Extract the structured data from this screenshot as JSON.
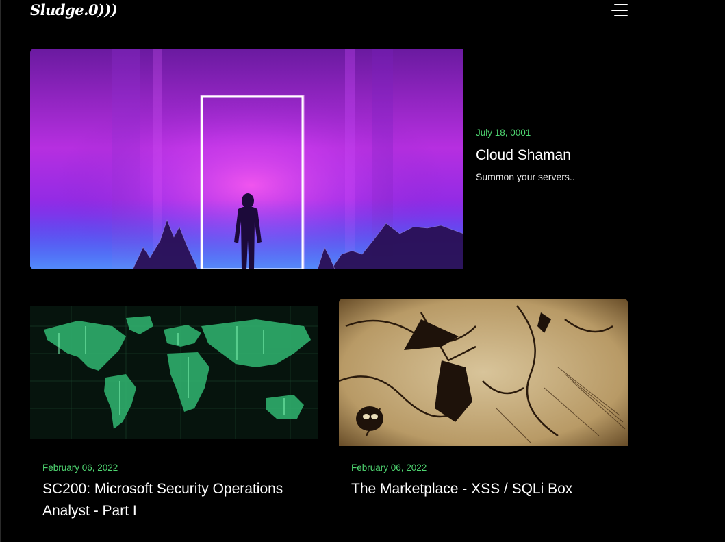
{
  "header": {
    "logo_text": "Sludge.0)))",
    "menu_icon": "hamburger-menu-icon"
  },
  "featured_post": {
    "date": "July 18, 0001",
    "title": "Cloud Shaman",
    "excerpt": "Summon your servers..",
    "image_icon": "neon-portal-silhouette-image"
  },
  "posts": [
    {
      "date": "February 06, 2022",
      "title": "SC200: Microsoft Security Operations Analyst - Part I",
      "image_icon": "green-world-map-image"
    },
    {
      "date": "February 06, 2022",
      "title": "The Marketplace - XSS / SQLi Box",
      "image_icon": "sepia-illustration-image"
    }
  ],
  "colors": {
    "background": "#000000",
    "date_accent": "#4fd671",
    "text": "#ffffff",
    "neon_purple": "#c03cf0",
    "map_green": "#3fcf8a",
    "sepia": "#c9b287"
  }
}
